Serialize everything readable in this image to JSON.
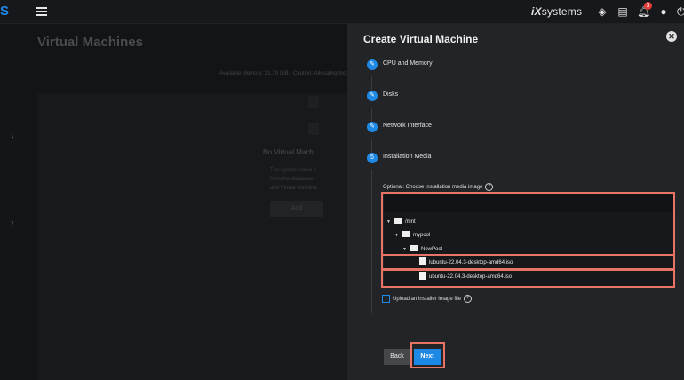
{
  "app": {
    "logo_letter": "S",
    "brand": "systems",
    "brand_mark": "iX"
  },
  "topbar": {
    "notification_count": "3"
  },
  "background": {
    "page_title": "Virtual Machines",
    "memory_text": "Available Memory: 31.79 GiB - Caution: Allocating too",
    "empty_title": "No Virtual Machi",
    "empty_text_lines": [
      "The system could n",
      "from the database.",
      "add Virtual Machine"
    ],
    "add_button": "Add"
  },
  "panel": {
    "title": "Create Virtual Machine",
    "steps": [
      {
        "label": "CPU and Memory",
        "state": "edit"
      },
      {
        "label": "Disks",
        "state": "edit"
      },
      {
        "label": "Network Interface",
        "state": "edit"
      },
      {
        "label": "Installation Media",
        "state": "active",
        "number": "5"
      }
    ],
    "media_label": "Optional: Choose installation media image",
    "tree": [
      {
        "label": "/mnt",
        "type": "folder"
      },
      {
        "label": "mypool",
        "type": "folder"
      },
      {
        "label": "NewPool",
        "type": "folder"
      },
      {
        "label": "lubuntu-22.04.3-desktop-amd64.iso",
        "type": "file"
      },
      {
        "label": "ubuntu-22.04.3-desktop-amd64.iso",
        "type": "file"
      }
    ],
    "upload_label": "Upload an installer image file",
    "back_label": "Back",
    "next_label": "Next"
  },
  "colors": {
    "accent": "#1e88e5",
    "highlight": "#e87466",
    "panel_bg": "#232427"
  }
}
